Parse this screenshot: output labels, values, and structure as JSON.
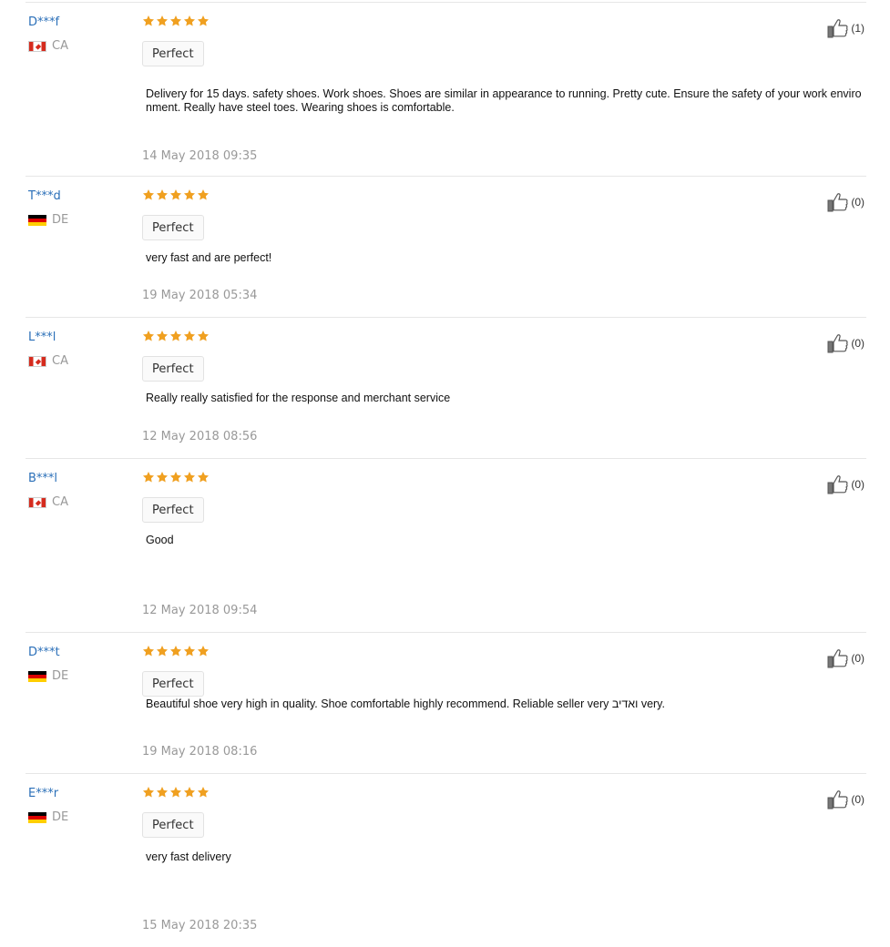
{
  "reviews": [
    {
      "name": "D***f",
      "country": "CA",
      "flag": "ca",
      "stars": 5,
      "tag": "Perfect",
      "text": "Delivery for 15 days. safety shoes. Work shoes. Shoes are similar in appearance to running. Pretty cute. Ensure the safety of your work environment. Really have steel toes. Wearing shoes is comfortable.",
      "date": "14 May 2018 09:35",
      "helpful": "(1)"
    },
    {
      "name": "T***d",
      "country": "DE",
      "flag": "de",
      "stars": 5,
      "tag": "Perfect",
      "text": "very fast and are perfect!",
      "date": "19 May 2018 05:34",
      "helpful": "(0)"
    },
    {
      "name": "L***l",
      "country": "CA",
      "flag": "ca",
      "stars": 5,
      "tag": "Perfect",
      "text": "Really really satisfied for the response and merchant service",
      "date": "12 May 2018 08:56",
      "helpful": "(0)"
    },
    {
      "name": "B***l",
      "country": "CA",
      "flag": "ca",
      "stars": 5,
      "tag": "Perfect",
      "text": "Good",
      "date": "12 May 2018 09:54",
      "helpful": "(0)"
    },
    {
      "name": "D***t",
      "country": "DE",
      "flag": "de",
      "stars": 5,
      "tag": "Perfect",
      "text": "Beautiful shoe very high in quality. Shoe comfortable highly recommend. Reliable seller very ואדיב very.",
      "date": "19 May 2018 08:16",
      "helpful": "(0)"
    },
    {
      "name": "E***r",
      "country": "DE",
      "flag": "de",
      "stars": 5,
      "tag": "Perfect",
      "text": "very fast delivery",
      "date": "15 May 2018 20:35",
      "helpful": "(0)"
    }
  ],
  "colors": {
    "star": "#f0a020",
    "name": "#2a6fb8",
    "muted": "#999999"
  },
  "icons": {
    "star": "star-icon",
    "helpful": "thumbs-up-icon"
  }
}
